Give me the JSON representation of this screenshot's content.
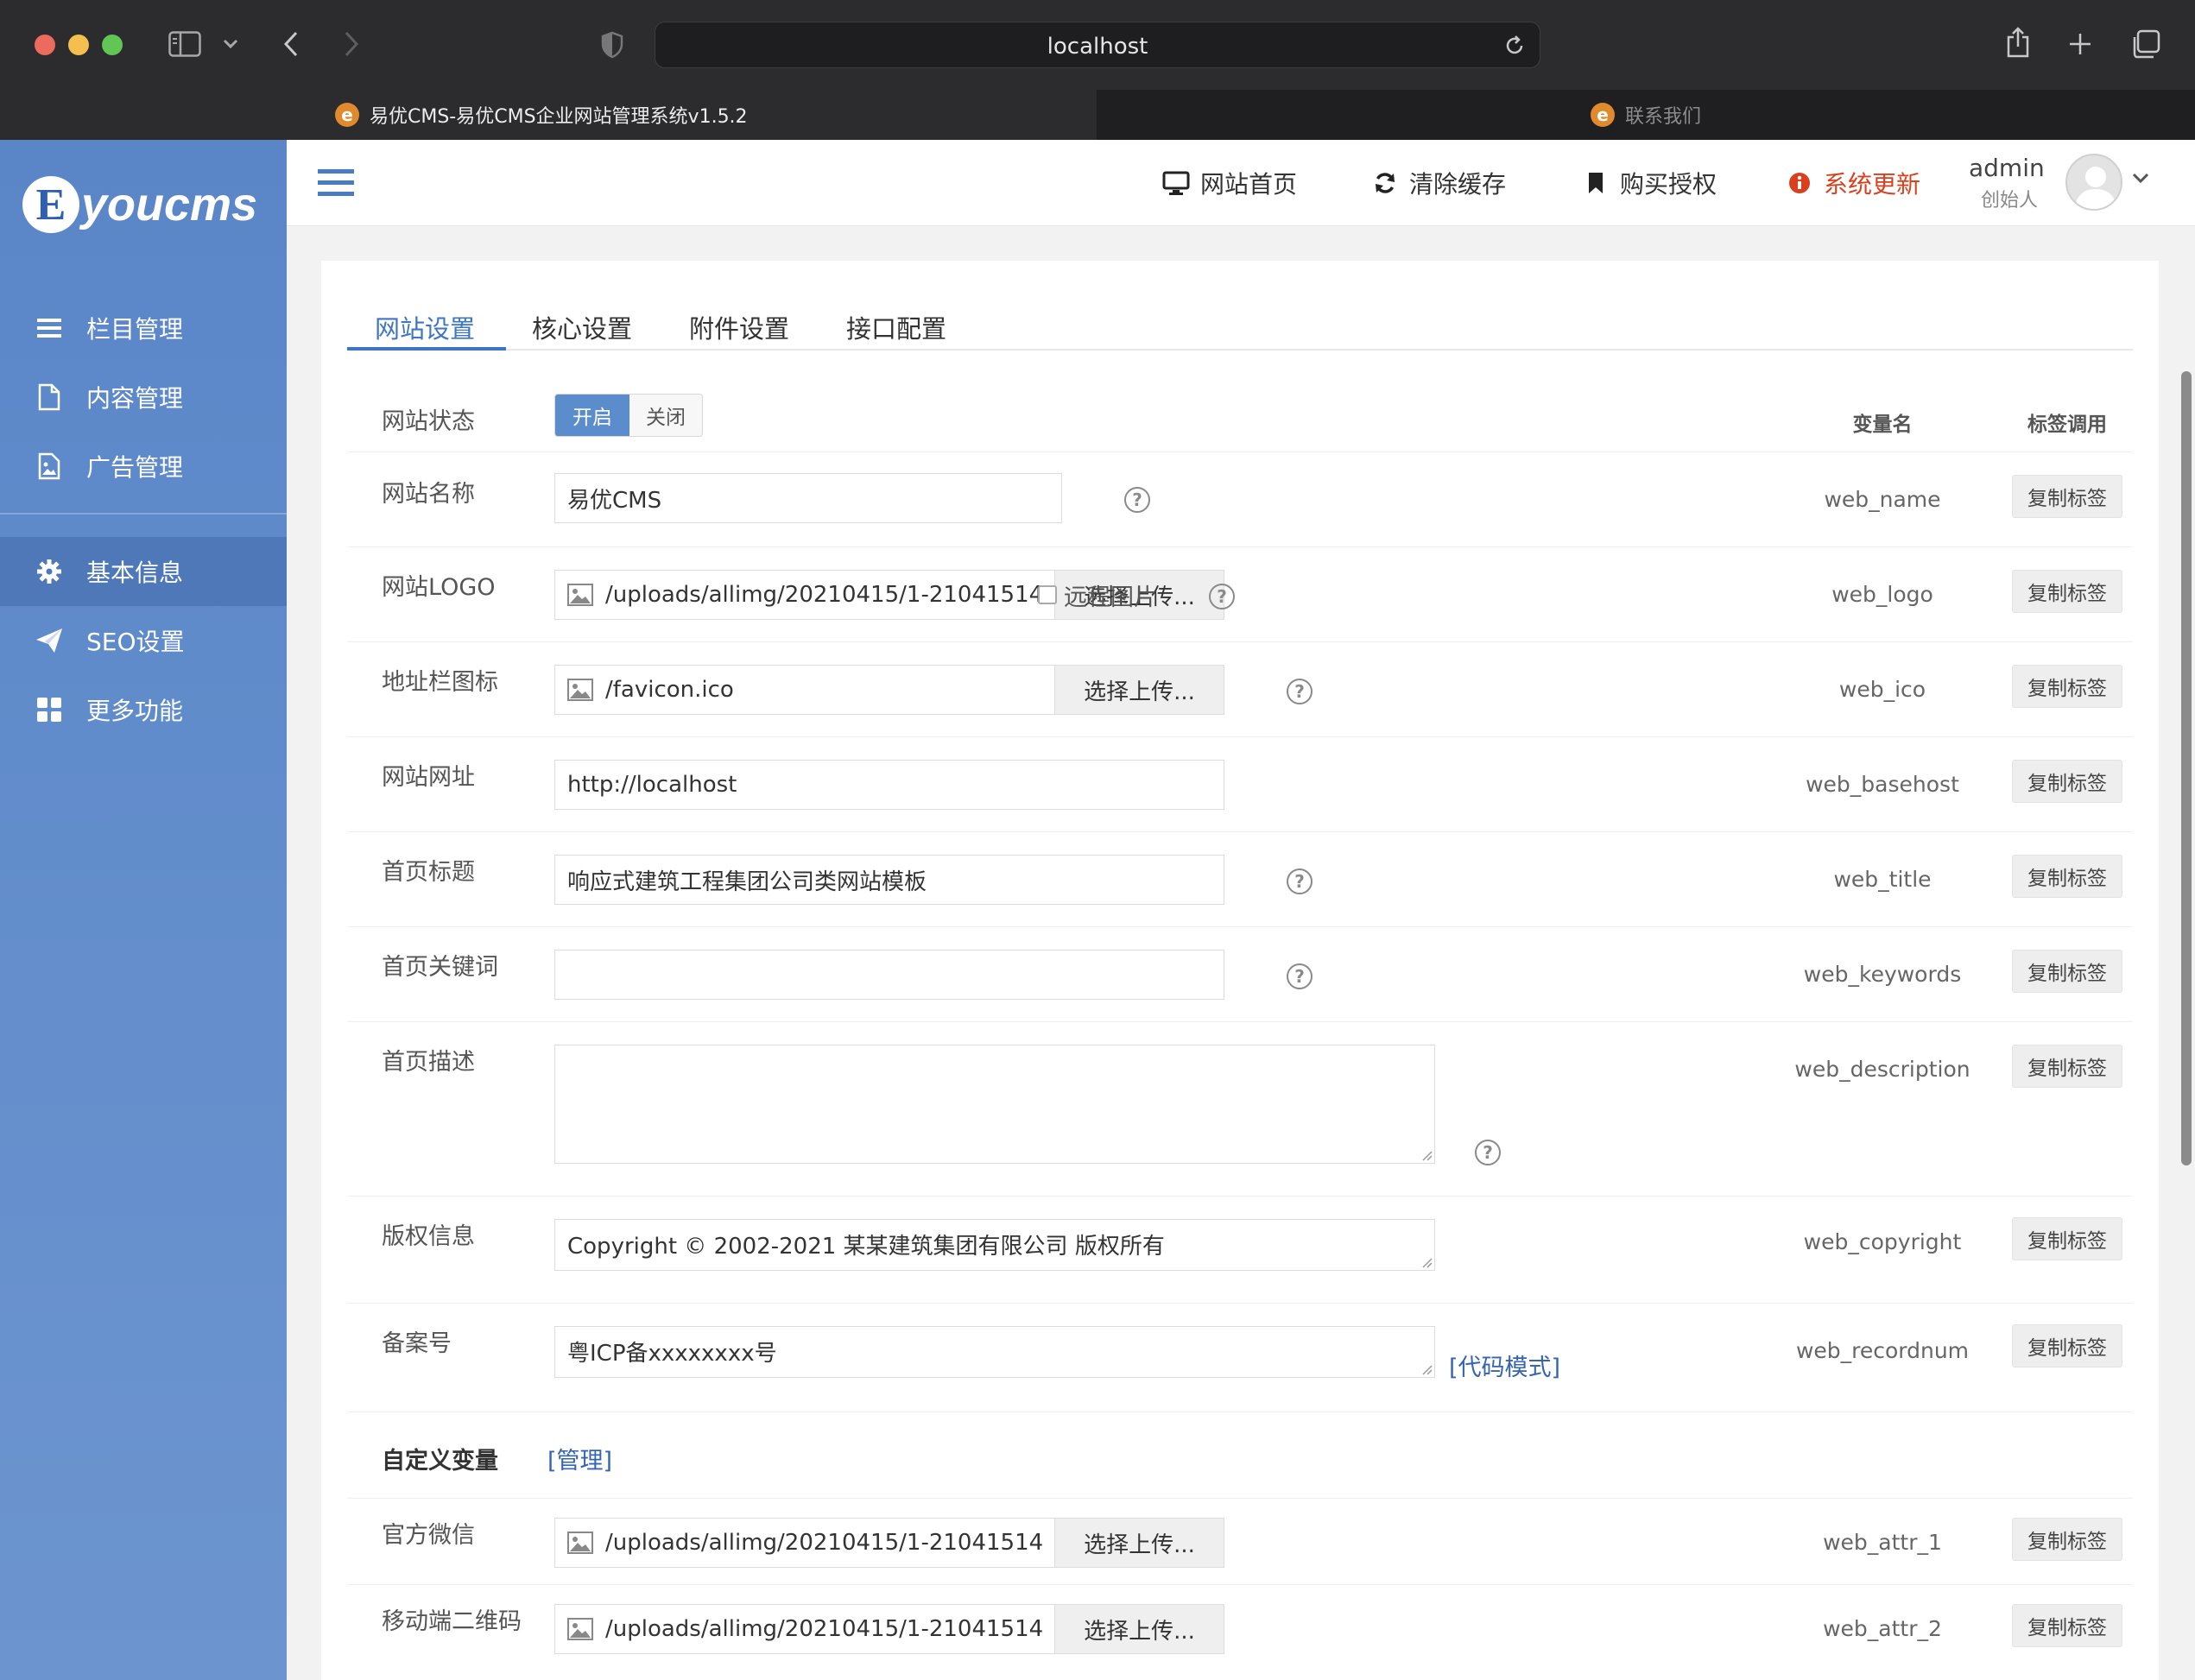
{
  "browser": {
    "address": "localhost",
    "tabs": [
      {
        "title": "易优CMS-易优CMS企业网站管理系统v1.5.2",
        "favicon": "e"
      },
      {
        "title": "联系我们",
        "favicon": "e"
      }
    ]
  },
  "sidebar": {
    "logo_letter": "E",
    "logo_text": "youcms",
    "items": [
      {
        "label": "栏目管理",
        "icon": "list-icon"
      },
      {
        "label": "内容管理",
        "icon": "document-icon"
      },
      {
        "label": "广告管理",
        "icon": "image-document-icon"
      },
      {
        "label": "基本信息",
        "icon": "gear-icon",
        "active": true
      },
      {
        "label": "SEO设置",
        "icon": "paper-plane-icon"
      },
      {
        "label": "更多功能",
        "icon": "grid-icon"
      }
    ]
  },
  "topbar": {
    "links": [
      {
        "label": "网站首页",
        "icon": "monitor-icon"
      },
      {
        "label": "清除缓存",
        "icon": "refresh-icon"
      },
      {
        "label": "购买授权",
        "icon": "bookmark-icon"
      },
      {
        "label": "系统更新",
        "icon": "info-icon"
      }
    ],
    "user_name": "admin",
    "user_role": "创始人"
  },
  "tabs": [
    "网站设置",
    "核心设置",
    "附件设置",
    "接口配置"
  ],
  "columns": {
    "var_name": "变量名",
    "tag_call": "标签调用"
  },
  "copy_label": "复制标签",
  "upload_label": "选择上传...",
  "help_glyph": "?",
  "form": {
    "status": {
      "label": "网站状态",
      "on": "开启",
      "off": "关闭"
    },
    "web_name": {
      "label": "网站名称",
      "value": "易优CMS",
      "var": "web_name"
    },
    "web_logo": {
      "label": "网站LOGO",
      "value": "/uploads/allimg/20210415/1-21041514",
      "var": "web_logo",
      "remote_label": "远程图片"
    },
    "web_ico": {
      "label": "地址栏图标",
      "value": "/favicon.ico",
      "var": "web_ico"
    },
    "web_basehost": {
      "label": "网站网址",
      "value": "http://localhost",
      "var": "web_basehost"
    },
    "web_title": {
      "label": "首页标题",
      "value": "响应式建筑工程集团公司类网站模板",
      "var": "web_title"
    },
    "web_keywords": {
      "label": "首页关键词",
      "value": "",
      "var": "web_keywords"
    },
    "web_description": {
      "label": "首页描述",
      "value": "",
      "var": "web_description"
    },
    "web_copyright": {
      "label": "版权信息",
      "value": "Copyright © 2002-2021 某某建筑集团有限公司 版权所有",
      "var": "web_copyright"
    },
    "web_recordnum": {
      "label": "备案号",
      "value": "粤ICP备xxxxxxxx号",
      "var": "web_recordnum",
      "code_mode": "[代码模式]"
    },
    "custom": {
      "label": "自定义变量",
      "manage": "[管理]"
    },
    "web_attr_1": {
      "label": "官方微信",
      "value": "/uploads/allimg/20210415/1-21041514",
      "var": "web_attr_1"
    },
    "web_attr_2": {
      "label": "移动端二维码",
      "value": "/uploads/allimg/20210415/1-21041514",
      "var": "web_attr_2"
    }
  },
  "colors": {
    "accent": "#3f76c4",
    "sidebar": "#5a86c8",
    "update": "#d9401d"
  }
}
